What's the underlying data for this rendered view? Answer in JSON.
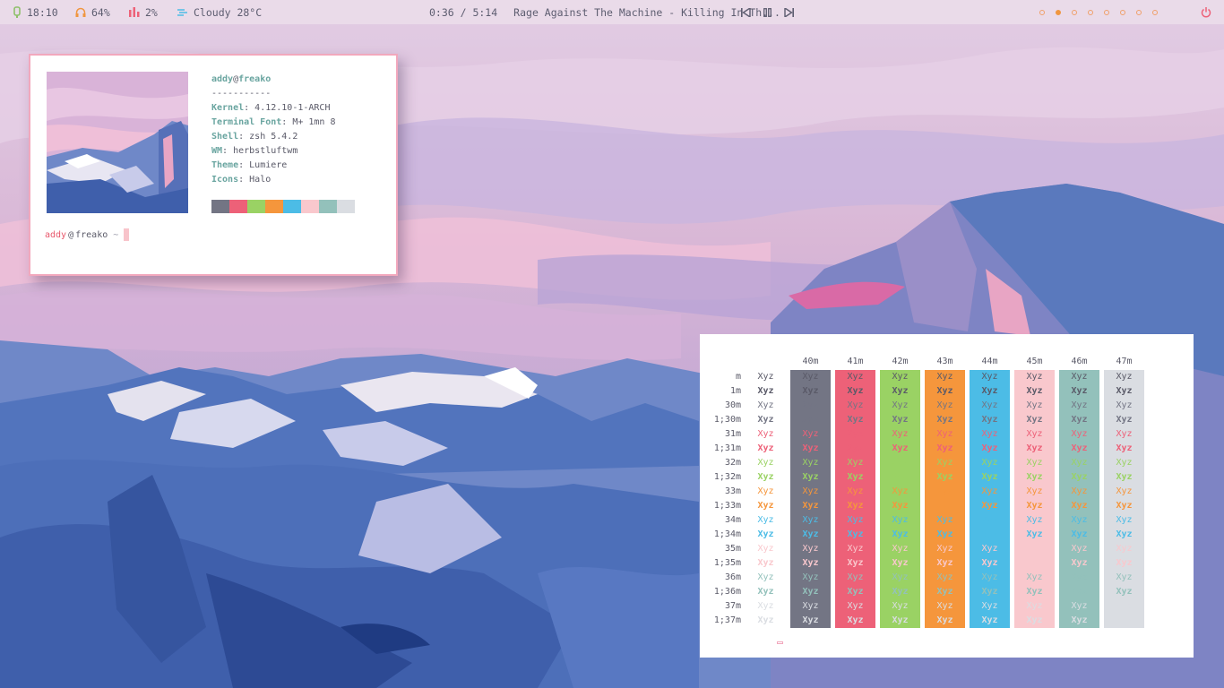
{
  "topbar": {
    "time": "18:10",
    "volume": "64%",
    "cpu": "2%",
    "weather": "Cloudy 28°C",
    "media_progress": "0:36 / 5:14",
    "media_title": "Rage Against The Machine - Killing In Th...",
    "workspaces": 8,
    "active_workspace": 2
  },
  "neofetch": {
    "user": "addy",
    "at": "@",
    "host": "freako",
    "separator": "-----------",
    "fields": [
      {
        "key": "Kernel",
        "value": "4.12.10-1-ARCH"
      },
      {
        "key": "Terminal Font",
        "value": "M+ 1mn 8"
      },
      {
        "key": "Shell",
        "value": "zsh 5.4.2"
      },
      {
        "key": "WM",
        "value": "herbstluftwm"
      },
      {
        "key": "Theme",
        "value": "Lumiere"
      },
      {
        "key": "Icons",
        "value": "Halo"
      }
    ],
    "prompt_user": "addy",
    "prompt_host": "freako",
    "prompt_symbol": "~",
    "palette": [
      "#737584",
      "#ed6178",
      "#9ad264",
      "#f5963c",
      "#4cbce6",
      "#f9c8cd",
      "#93c1bb",
      "#dadde2"
    ]
  },
  "colortable": {
    "bg_headers": [
      "40m",
      "41m",
      "42m",
      "43m",
      "44m",
      "45m",
      "46m",
      "47m"
    ],
    "fg_rows": [
      "m",
      "1m",
      "30m",
      "1;30m",
      "31m",
      "1;31m",
      "32m",
      "1;32m",
      "33m",
      "1;33m",
      "34m",
      "1;34m",
      "35m",
      "1;35m",
      "36m",
      "1;36m",
      "37m",
      "1;37m"
    ],
    "sample": "Xyz",
    "bg_colors": [
      "#737584",
      "#ed6178",
      "#9ad264",
      "#f5963c",
      "#4cbce6",
      "#f9c8cd",
      "#93c1bb",
      "#dadde2"
    ],
    "fg_colors": [
      "#737584",
      "#ed6178",
      "#9ad264",
      "#f5963c",
      "#4cbce6",
      "#f9c8cd",
      "#93c1bb",
      "#dadde2"
    ],
    "default_fg": "#5a5a68"
  }
}
